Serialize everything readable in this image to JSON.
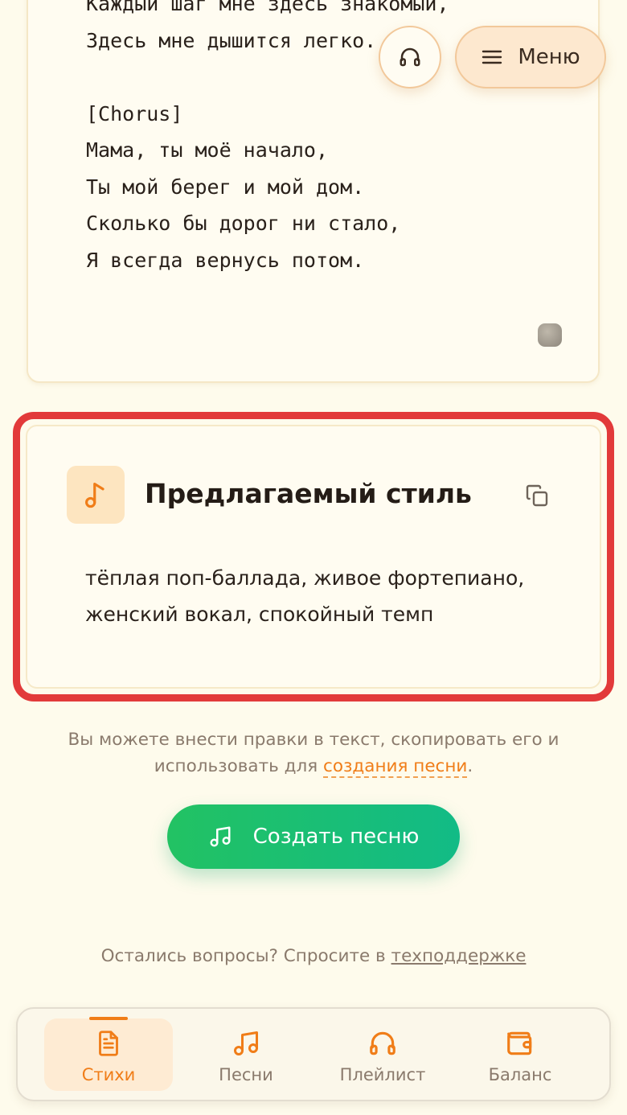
{
  "lyrics": {
    "lines": [
      "Каждый шаг мне здесь знакомый,",
      "Здесь мне дышится легко.",
      "",
      "[Chorus]",
      "Мама, ты моё начало,",
      "Ты мой берег и мой дом.",
      "Сколько бы дорог ни стало,",
      "Я всегда вернусь потом."
    ]
  },
  "header": {
    "menu_label": "Меню"
  },
  "style_card": {
    "title": "Предлагаемый стиль",
    "description": "тёплая поп-баллада, живое фортепиано, женский вокал, спокойный темп"
  },
  "hint": {
    "text_before": "Вы можете внести правки в текст, скопировать его и использовать для ",
    "link": "создания песни",
    "text_after": "."
  },
  "create_button": {
    "label": "Создать песню"
  },
  "support": {
    "text": "Остались вопросы? Спросите в ",
    "link": "техподдержке"
  },
  "nav": {
    "items": [
      {
        "label": "Стихи",
        "icon": "document-icon",
        "active": true
      },
      {
        "label": "Песни",
        "icon": "music-notes-icon",
        "active": false
      },
      {
        "label": "Плейлист",
        "icon": "headphones-icon",
        "active": false
      },
      {
        "label": "Баланс",
        "icon": "wallet-icon",
        "active": false
      }
    ]
  },
  "colors": {
    "accent": "#f07d18",
    "highlight_frame": "#e23a3a",
    "create_button": "#1ebf72",
    "background": "#fefbec"
  }
}
